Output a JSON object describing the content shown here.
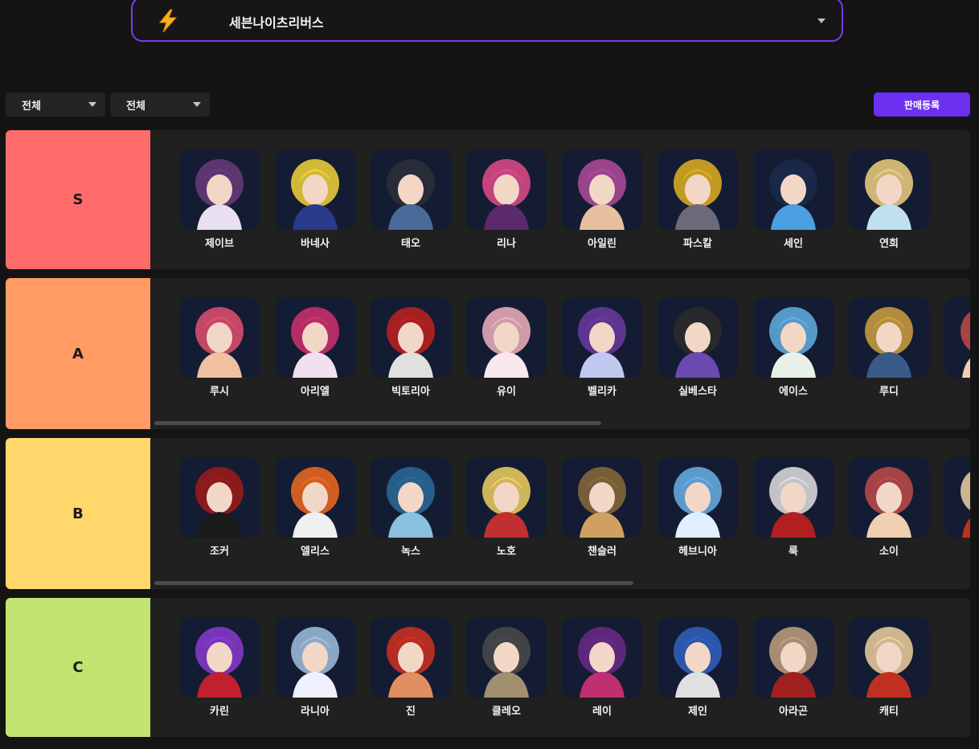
{
  "game_selector": {
    "name": "세븐나이츠리버스",
    "icon": "lightning-bolt-icon"
  },
  "filters": [
    {
      "value": "전체"
    },
    {
      "value": "전체"
    }
  ],
  "register_button": {
    "label": "판매등록"
  },
  "tiers": [
    {
      "label": "S",
      "color": "#ff6b6b",
      "characters": [
        "제이브",
        "바네사",
        "태오",
        "리나",
        "아일린",
        "파스칼",
        "세인",
        "연희"
      ]
    },
    {
      "label": "A",
      "color": "#ff9b63",
      "characters": [
        "루시",
        "아리엘",
        "빅토리아",
        "유이",
        "벨리카",
        "실베스타",
        "에이스",
        "루디"
      ]
    },
    {
      "label": "B",
      "color": "#ffd76a",
      "characters": [
        "조커",
        "엘리스",
        "녹스",
        "노호",
        "챈슬러",
        "헤브니아",
        "룩",
        "소이"
      ]
    },
    {
      "label": "C",
      "color": "#c1e36f",
      "characters": [
        "카린",
        "라니아",
        "진",
        "클레오",
        "레이",
        "제인",
        "아라곤",
        "캐티"
      ]
    }
  ],
  "colors": {
    "accent": "#6d2ff0",
    "selector_border": "#7a3cf0",
    "background": "#141414",
    "row_background": "#202020"
  }
}
